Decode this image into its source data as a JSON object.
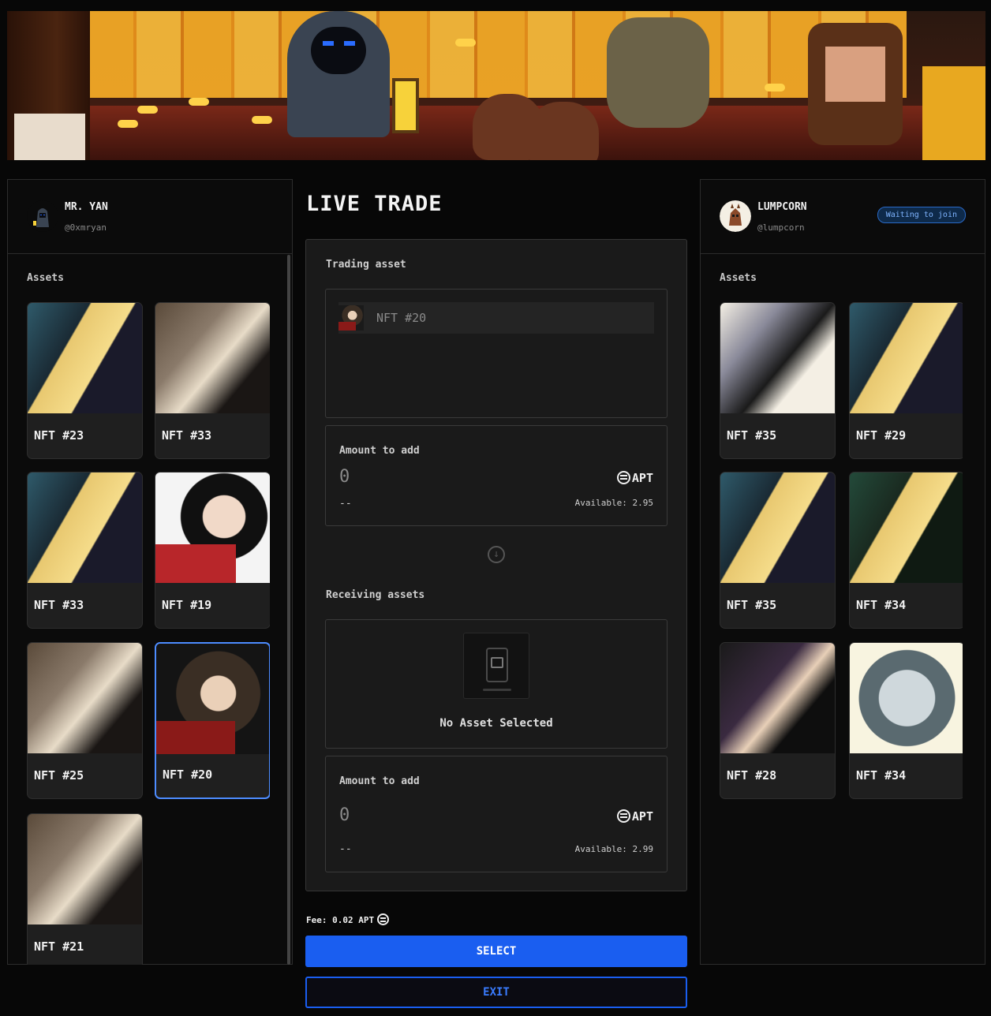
{
  "left_user": {
    "name": "MR. YAN",
    "handle": "@0xmryan",
    "assets_label": "Assets",
    "assets": [
      {
        "label": "NFT #23",
        "art": "blonde-knight",
        "selected": false
      },
      {
        "label": "NFT #33",
        "art": "beast-skull",
        "selected": false
      },
      {
        "label": "NFT #33",
        "art": "blonde-knight",
        "selected": false
      },
      {
        "label": "NFT #19",
        "art": "red-dress-girl",
        "selected": false
      },
      {
        "label": "NFT #25",
        "art": "beast-skull",
        "selected": false
      },
      {
        "label": "NFT #20",
        "art": "brown-hair-girl",
        "selected": true
      },
      {
        "label": "NFT #21",
        "art": "beast-skull",
        "selected": false
      }
    ]
  },
  "right_user": {
    "name": "LUMPCORN",
    "handle": "@lumpcorn",
    "status_badge": "Waiting to join",
    "assets_label": "Assets",
    "assets": [
      {
        "label": "NFT #35",
        "art": "oni-mask"
      },
      {
        "label": "NFT #29",
        "art": "blonde-knight"
      },
      {
        "label": "NFT #35",
        "art": "blonde-knight"
      },
      {
        "label": "NFT #34",
        "art": "blonde-green-flame"
      },
      {
        "label": "NFT #28",
        "art": "dark-demon"
      },
      {
        "label": "NFT #34",
        "art": "white-wolf"
      }
    ]
  },
  "trade": {
    "title": "LIVE TRADE",
    "trading_label": "Trading asset",
    "trading_item": "NFT #20",
    "amount_top": {
      "label": "Amount to add",
      "value": "0",
      "currency": "APT",
      "sub": "--",
      "available": "Available: 2.95"
    },
    "receiving_label": "Receiving assets",
    "empty_text": "No Asset Selected",
    "amount_bottom": {
      "label": "Amount to add",
      "value": "0",
      "currency": "APT",
      "sub": "--",
      "available": "Available: 2.99"
    },
    "fee": "Fee: 0.02 APT",
    "select_label": "SELECT",
    "exit_label": "EXIT"
  },
  "colors": {
    "accent": "#1a5ef0",
    "selected_border": "#4d8cff",
    "background": "#070707"
  }
}
